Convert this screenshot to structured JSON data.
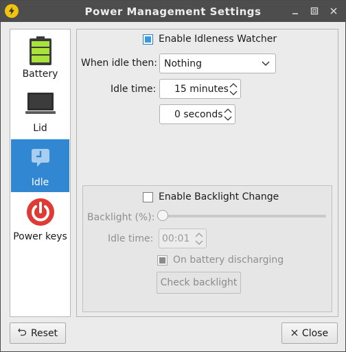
{
  "window": {
    "title": "Power Management Settings"
  },
  "sidebar": {
    "items": [
      {
        "label": "Battery",
        "icon": "battery-icon",
        "active": false
      },
      {
        "label": "Lid",
        "icon": "laptop-lid-icon",
        "active": false
      },
      {
        "label": "Idle",
        "icon": "idle-chat-icon",
        "active": true
      },
      {
        "label": "Power keys",
        "icon": "power-icon",
        "active": false
      }
    ]
  },
  "idle": {
    "enable_label": "Enable Idleness Watcher",
    "enable_checked": true,
    "when_idle_label": "When idle then:",
    "when_idle_value": "Nothing",
    "idle_time_label": "Idle time:",
    "idle_minutes_value": "15 minutes",
    "idle_seconds_value": "0 seconds"
  },
  "backlight": {
    "enable_label": "Enable Backlight Change",
    "enable_checked": false,
    "backlight_label": "Backlight (%):",
    "backlight_value": 0,
    "idle_time_label": "Idle time:",
    "idle_time_value": "00:01",
    "on_battery_label": "On battery discharging",
    "on_battery_checked": true,
    "check_button_label": "Check backlight"
  },
  "footer": {
    "reset_label": "Reset",
    "close_label": "Close"
  },
  "colors": {
    "accent": "#3287d2",
    "titlebar": "#4d4d4d",
    "power_red": "#e03a35",
    "battery_green": "#a8e23a"
  }
}
